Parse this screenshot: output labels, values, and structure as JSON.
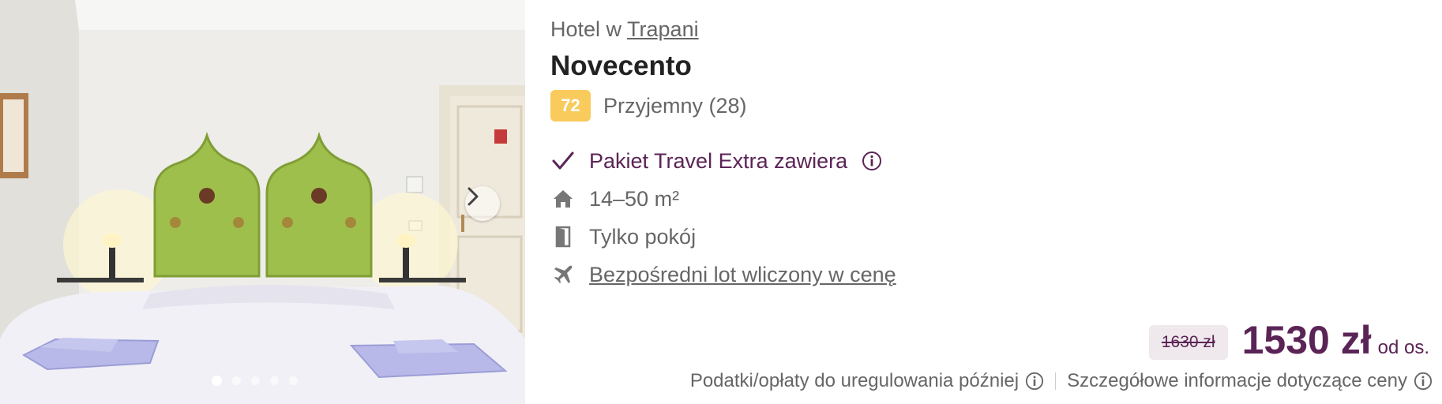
{
  "photo": {
    "alt": "Hotel room with two green headboards",
    "dots_count": 5,
    "active_dot": 0
  },
  "hotel": {
    "location_prefix": "Hotel w",
    "city": "Trapani",
    "name": "Novecento"
  },
  "rating": {
    "score": "72",
    "label": "Przyjemny (28)",
    "score_color": "#f9ca5c"
  },
  "features": [
    {
      "icon": "check-icon",
      "text": "Pakiet Travel Extra zawiera"
    },
    {
      "icon": "house-icon",
      "text": "14–50 m²"
    },
    {
      "icon": "door-icon",
      "text": "Tylko pokój"
    },
    {
      "icon": "plane-icon",
      "text": "Bezpośredni lot wliczony w cenę"
    }
  ],
  "price": {
    "old": "1630 zł",
    "current": "1530 zł",
    "per": "od os.",
    "accent_color": "#5b2456"
  },
  "fees": {
    "taxes_text": "Podatki/opłaty do uregulowania później",
    "details_text": "Szczegółowe informacje dotyczące ceny"
  }
}
